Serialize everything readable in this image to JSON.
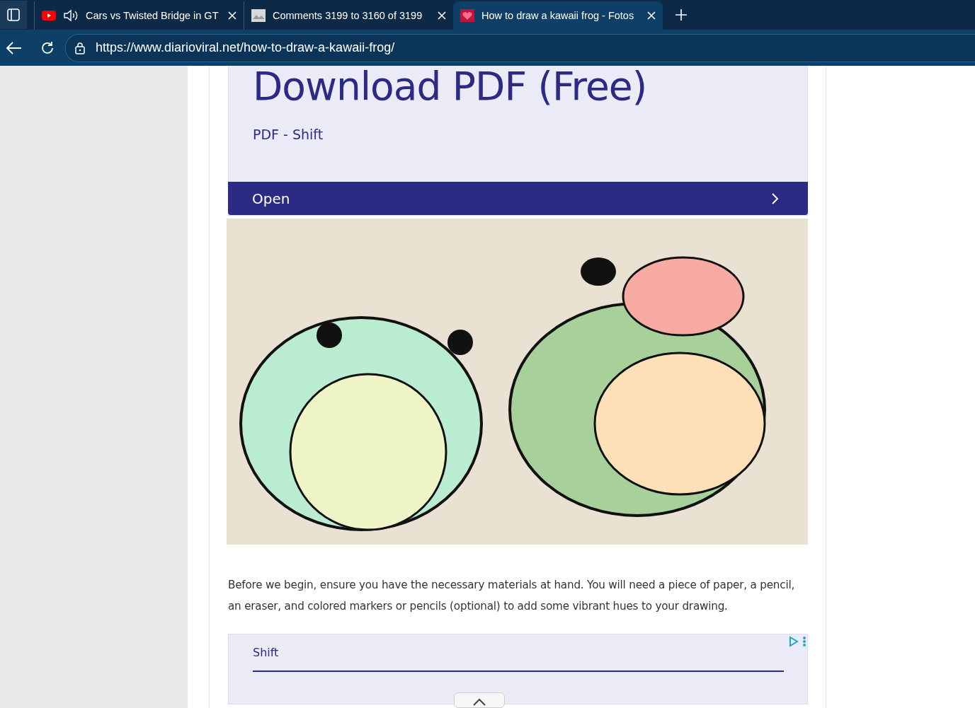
{
  "tabs": [
    {
      "kind": "video",
      "title": "Cars vs Twisted Bridge in GT",
      "audio": true,
      "selected": false
    },
    {
      "kind": "thumbnail",
      "title": "Comments 3199 to 3160 of 3199",
      "audio": false,
      "selected": false
    },
    {
      "kind": "heart",
      "title": "How to draw a kawaii frog - Fotos",
      "audio": false,
      "selected": true
    }
  ],
  "address_bar": {
    "url": "https://www.diarioviral.net/how-to-draw-a-kawaii-frog/"
  },
  "ad_top": {
    "heading": "Download PDF (Free)",
    "subtitle": "PDF - Shift",
    "button": "Open"
  },
  "paragraph": "Before we begin, ensure you have the necessary materials at hand. You will need a piece of paper, a pencil, an eraser, and colored markers or pencils (optional) to add some vibrant hues to your drawing.",
  "ad_bottom": {
    "label": "Shift"
  }
}
